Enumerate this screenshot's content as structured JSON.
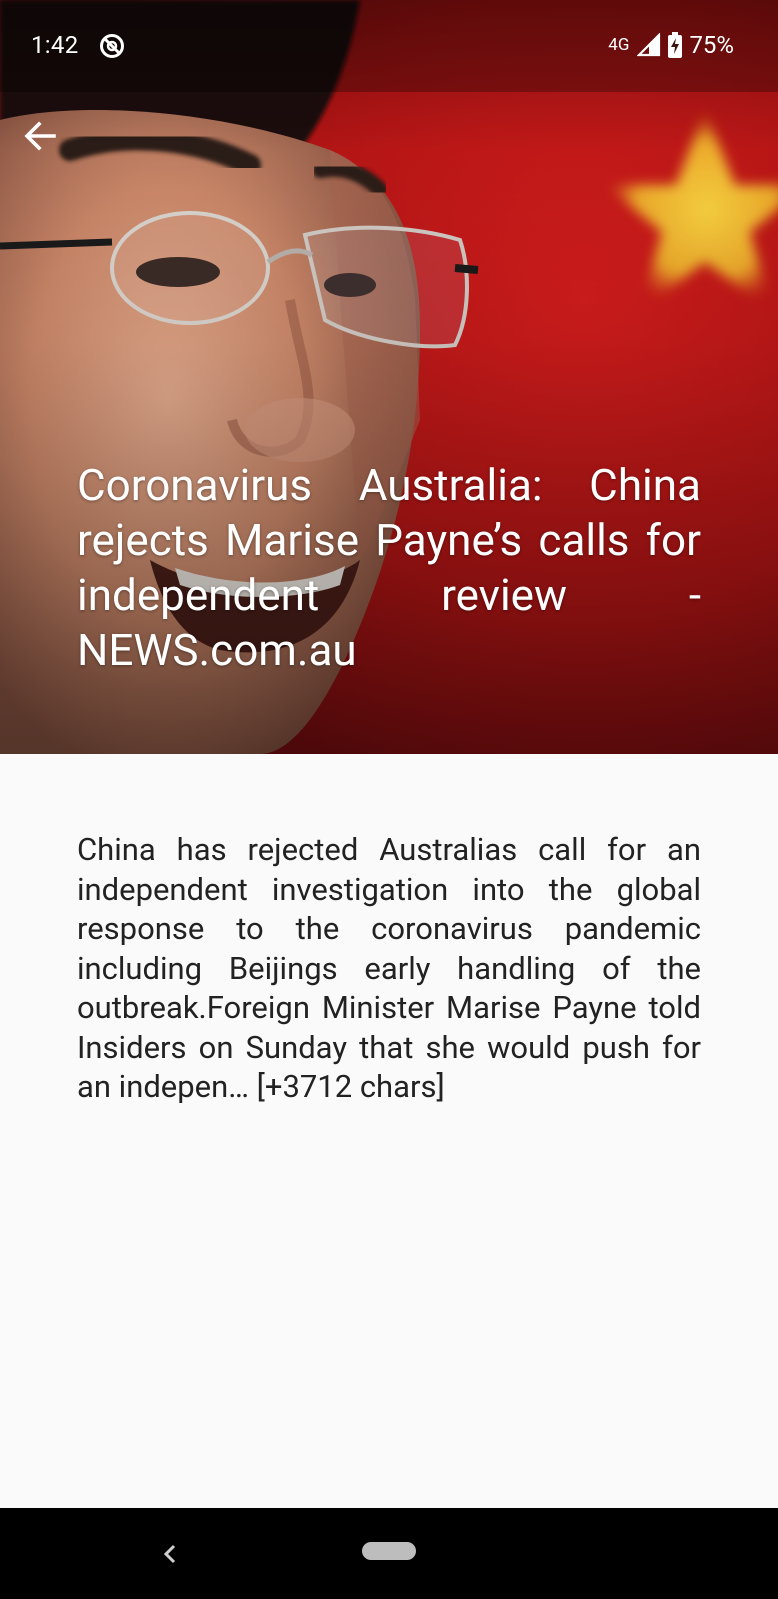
{
  "status_bar": {
    "time": "1:42",
    "network": "4G",
    "battery": "75%"
  },
  "article": {
    "title": "Coronavirus Australia: China rejects Marise Payne’s calls for independent review - NEWS.com.au",
    "body": "China has rejected Australias call for an independent investigation into the global response to the coronavirus pandemic including Beijings early handling of the outbreak.Foreign Minister Marise Payne told Insiders on Sunday that she would push for an indepen… [+3712 chars]"
  },
  "icons": {
    "back": "arrow-left-icon",
    "dnd": "do-not-disturb-icon",
    "signal": "cell-signal-icon",
    "battery": "battery-charging-icon",
    "nav_back": "chevron-left-icon",
    "nav_home": "home-pill"
  },
  "colors": {
    "flag_red": "#c0141a",
    "flag_star": "#f4c531",
    "page_background": "#fafafa",
    "navbar": "#000000"
  }
}
